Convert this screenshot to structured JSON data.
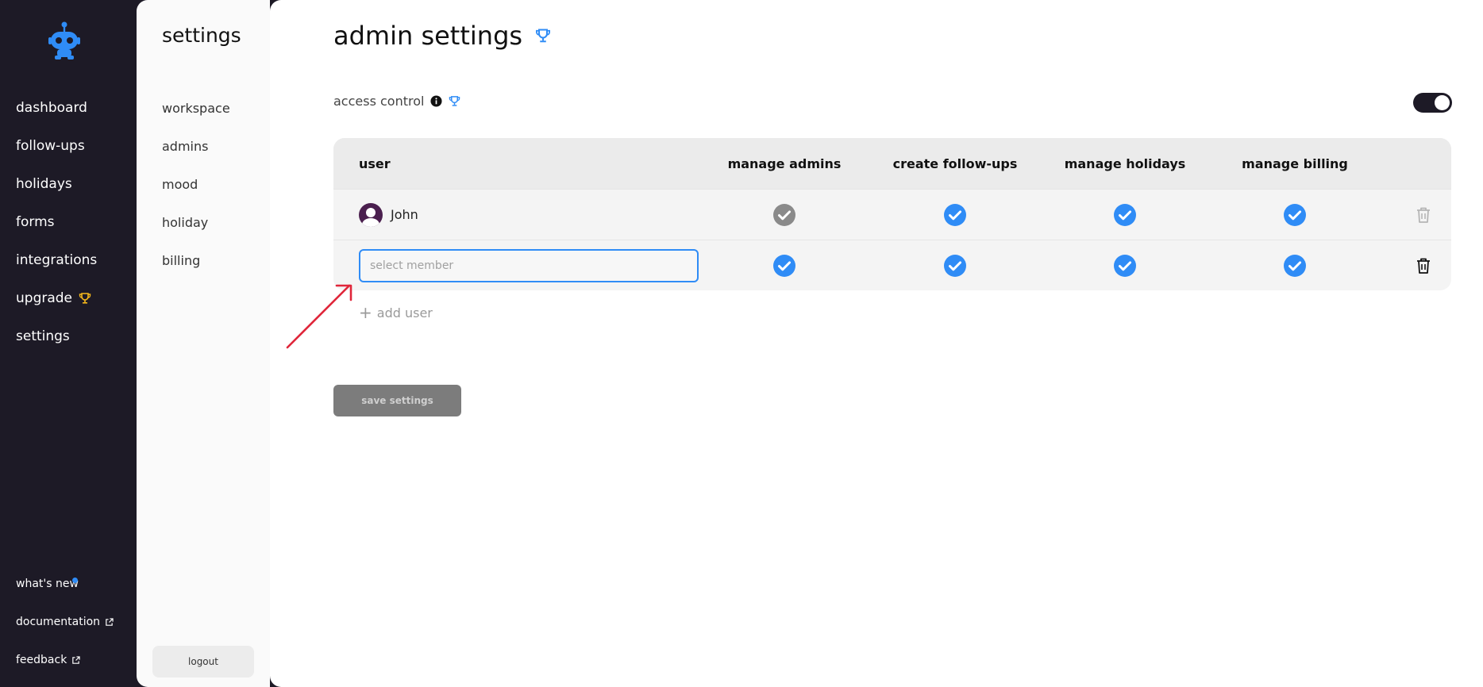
{
  "nav": {
    "items": [
      {
        "label": "dashboard"
      },
      {
        "label": "follow-ups"
      },
      {
        "label": "holidays"
      },
      {
        "label": "forms"
      },
      {
        "label": "integrations"
      },
      {
        "label": "upgrade"
      },
      {
        "label": "settings"
      }
    ],
    "bottom": [
      {
        "label": "what's new"
      },
      {
        "label": "documentation"
      },
      {
        "label": "feedback"
      }
    ]
  },
  "subnav": {
    "title": "settings",
    "items": [
      {
        "label": "workspace"
      },
      {
        "label": "admins"
      },
      {
        "label": "mood"
      },
      {
        "label": "holiday"
      },
      {
        "label": "billing"
      }
    ],
    "logout": "logout"
  },
  "main": {
    "title": "admin settings",
    "access_label": "access control",
    "table": {
      "headers": [
        "user",
        "manage admins",
        "create follow-ups",
        "manage holidays",
        "manage billing"
      ],
      "rows": [
        {
          "user": "John"
        }
      ],
      "member_placeholder": "select member"
    },
    "add_user": "add user",
    "save": "save settings"
  },
  "colors": {
    "accent": "#2f8cf6",
    "nav_bg": "#1d1a26",
    "disabled_check": "#8a8a8a",
    "trophy": "#f5b71b"
  }
}
